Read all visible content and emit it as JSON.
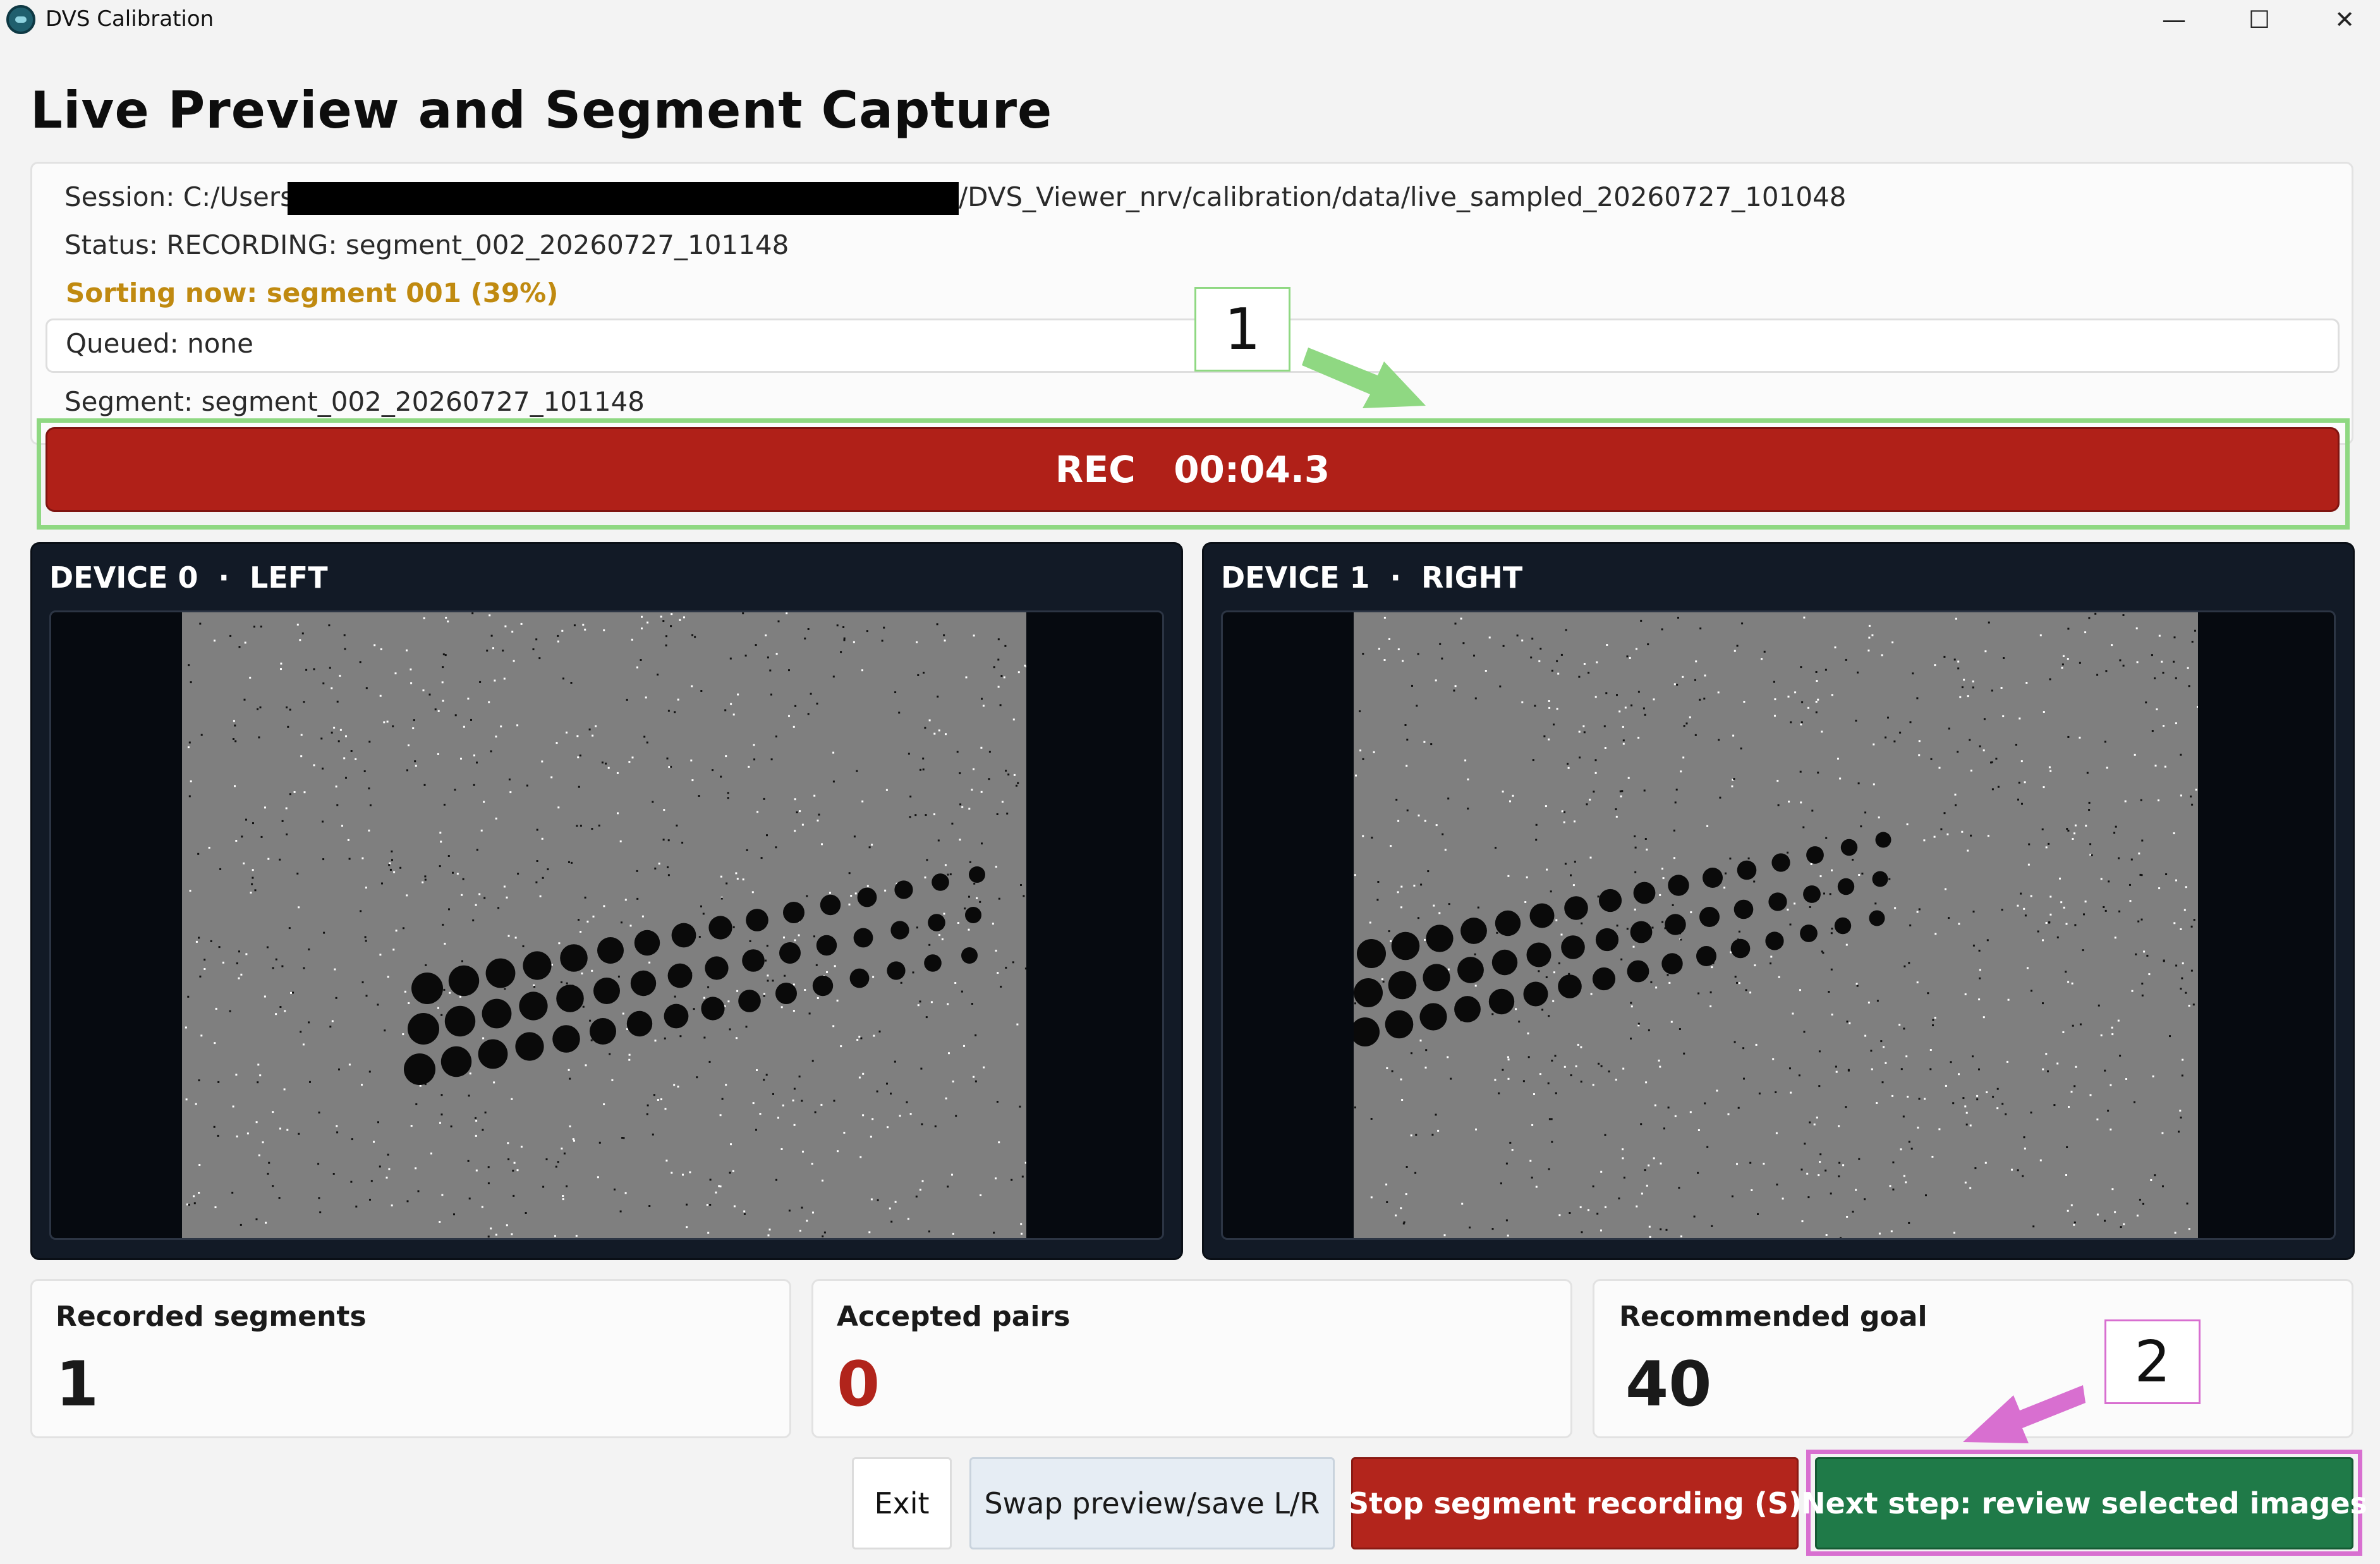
{
  "window": {
    "title": "DVS Calibration",
    "controls": {
      "minimize": "—",
      "maximize": "☐",
      "close": "✕"
    }
  },
  "page_title": "Live Preview and Segment Capture",
  "info": {
    "session_prefix": "Session: C:/Users/",
    "session_path": "/DVS_Viewer_nrv/calibration/data/live_sampled_20260727_101048",
    "status": "Status: RECORDING: segment_002_20260727_101148",
    "sorting": "Sorting now: segment 001 (39%)",
    "queued": "Queued: none",
    "segment": "Segment: segment_002_20260727_101148"
  },
  "recording": {
    "text": "REC   00:04.3",
    "color": "#b02018"
  },
  "annotations": {
    "label_1": "1",
    "label_2": "2",
    "color_1": "#8fd882",
    "color_2": "#d86fd0"
  },
  "devices": {
    "left": {
      "header": "DEVICE 0  ·  LEFT"
    },
    "right": {
      "header": "DEVICE 1  ·  RIGHT"
    }
  },
  "stats": {
    "recorded_segments": {
      "label": "Recorded segments",
      "value": "1"
    },
    "accepted_pairs": {
      "label": "Accepted pairs",
      "value": "0"
    },
    "recommended_goal": {
      "label": "Recommended goal",
      "value": "40"
    }
  },
  "buttons": {
    "exit": "Exit",
    "swap": "Swap preview/save L/R",
    "stop": "Stop segment recording (S)",
    "next": "Next step: review selected images"
  },
  "colors": {
    "accent_warning": "#c08a10",
    "danger": "#b1241b",
    "success": "#1f7a48",
    "preview_bg": "#121a26"
  }
}
